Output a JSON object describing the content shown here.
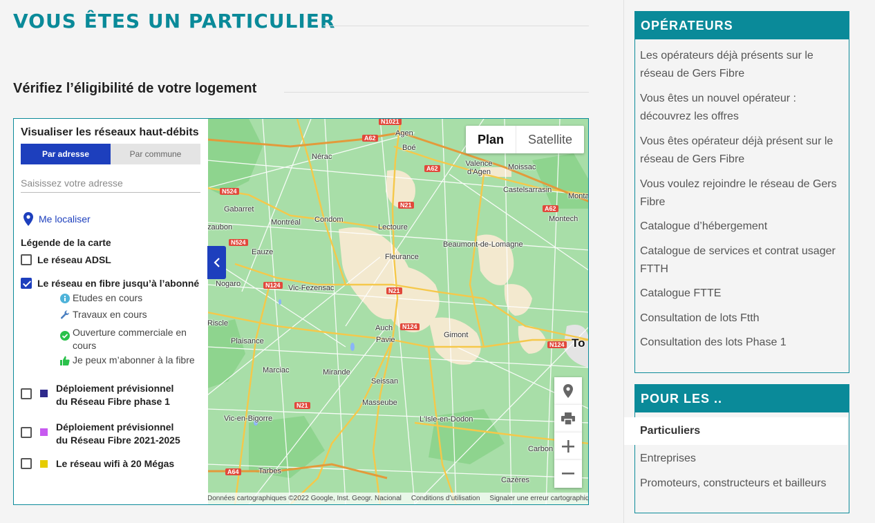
{
  "page": {
    "title": "VOUS ÊTES UN PARTICULIER",
    "section_title": "Vérifiez l’éligibilité de votre logement"
  },
  "panel": {
    "title": "Visualiser les réseaux haut-débits",
    "tabs": [
      "Par adresse",
      "Par commune"
    ],
    "address_placeholder": "Saisissez votre adresse",
    "locate_label": "Me localiser",
    "legend_title": "Légende de la carte",
    "layers": [
      {
        "label": "Le réseau ADSL",
        "checked": false
      },
      {
        "label": "Le réseau en fibre jusqu’à l’abonné",
        "checked": true
      },
      {
        "label": "Déploiement prévisionnel du Réseau Fibre phase 1",
        "checked": false,
        "color": "#2f2a8c"
      },
      {
        "label": "Déploiement prévisionnel du Réseau Fibre 2021-2025",
        "checked": false,
        "color": "#c75af0"
      },
      {
        "label": "Le réseau wifi à 20 Mégas",
        "checked": false,
        "color": "#e6cc00"
      }
    ],
    "fibre_status": [
      {
        "label": "Etudes en cours",
        "icon": "info-icon"
      },
      {
        "label": "Travaux en cours",
        "icon": "wrench-icon"
      },
      {
        "label": "Ouverture commerciale en cours",
        "icon": "check-circle-icon"
      },
      {
        "label": "Je peux m’abonner à la fibre",
        "icon": "thumbs-up-icon"
      }
    ]
  },
  "map": {
    "type_buttons": [
      "Plan",
      "Satellite"
    ],
    "attribution": [
      "Données cartographiques ©2022 Google, Inst. Geogr. Nacional",
      "Conditions d’utilisation",
      "Signaler une erreur cartographique"
    ],
    "places": [
      "Agen",
      "Boé",
      "Nérac",
      "Valence d'Agen",
      "Moissac",
      "Castelsarrasin",
      "Montaub",
      "Gabarret",
      "Montréal",
      "Condom",
      "Lectoure",
      "Montech",
      "zaubon",
      "Beaumont-de-Lomagne",
      "Eauze",
      "Fleurance",
      "Nogaro",
      "Vic-Fezensac",
      "Auch",
      "Pavie",
      "Gimont",
      "Riscle",
      "Plaisance",
      "Marciac",
      "Mirande",
      "Seissan",
      "Masseube",
      "Vic-en-Bigorre",
      "L'Isle-en-Dodon",
      "Tarbes",
      "Carbon",
      "Cazères",
      "To"
    ],
    "roads": [
      "N1021",
      "A62",
      "A62",
      "N524",
      "N21",
      "A62",
      "N524",
      "N124",
      "N21",
      "N124",
      "N124",
      "N21",
      "A64"
    ]
  },
  "sidebar": {
    "operateurs": {
      "title": "OPÉRATEURS",
      "links": [
        "Les opérateurs déjà présents sur le réseau de Gers Fibre",
        "Vous êtes un nouvel opérateur : découvrez les offres",
        "Vous êtes opérateur déjà présent sur le réseau de Gers Fibre",
        "Vous voulez rejoindre le réseau de Gers Fibre",
        "Catalogue d’hébergement",
        "Catalogue de services et contrat usager FTTH",
        "Catalogue FTTE",
        "Consultation de lots Ftth",
        "Consultation des lots Phase 1"
      ]
    },
    "pour_les": {
      "title": "POUR LES ..",
      "links": [
        "Particuliers",
        "Entreprises",
        "Promoteurs, constructeurs et bailleurs"
      ]
    }
  }
}
